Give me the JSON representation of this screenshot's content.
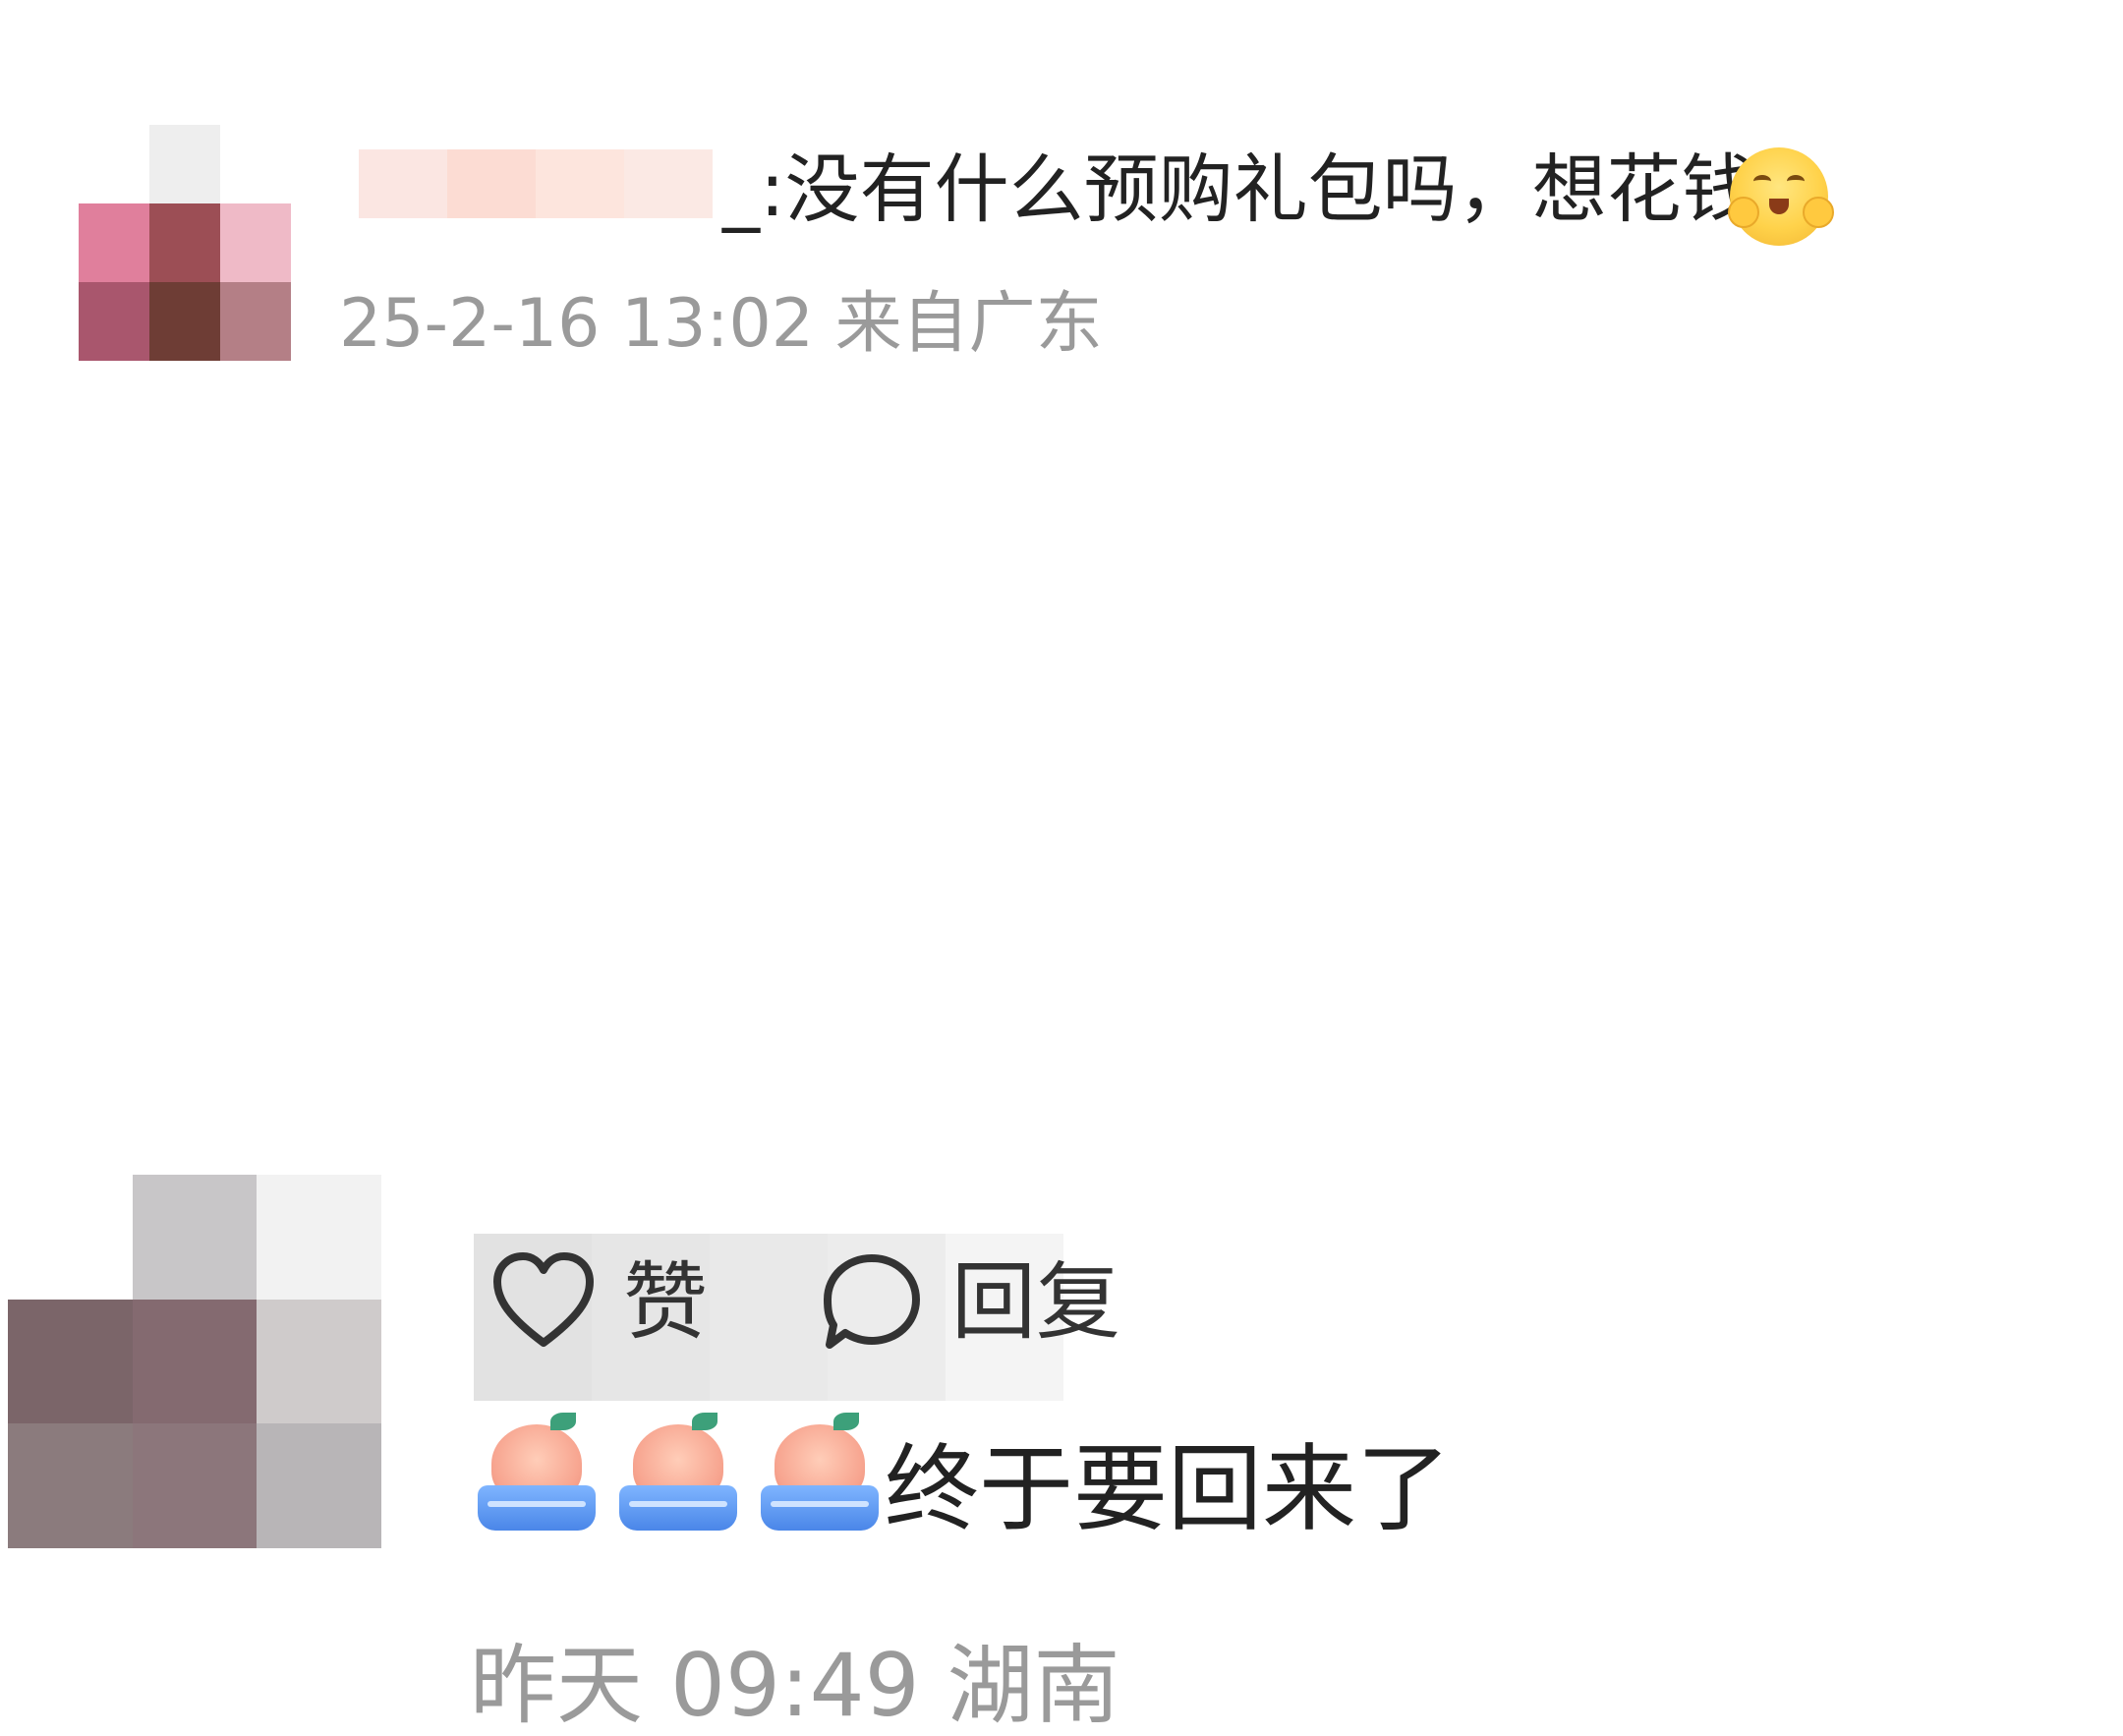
{
  "comments": [
    {
      "text": "_:没有什么预购礼包吗，想花钱",
      "meta": "25-2-16 13:02 来自广东",
      "emoji": "hugging-face-emoji",
      "avatar_colors": [
        "#f2f2f2",
        "#e9b9c7",
        "#f4cfd6",
        "#d98ca6",
        "#9c4b52",
        "#f0c6cd",
        "#a6556b",
        "#6b3b33",
        "#b07c83"
      ]
    },
    {
      "text": "终于要回来了",
      "meta": "昨天 09:49 湖南",
      "emoji": "peach-in-basin-emoji",
      "emoji_count": 3,
      "avatar_colors": [
        "#c9c6c8",
        "#a9a7ab",
        "#f1f1f1",
        "#7a6468",
        "#826a6e",
        "#cfcbcb",
        "#8a7a7c",
        "#8c767a",
        "#b7b4b6"
      ]
    }
  ],
  "actions": {
    "like_label": "赞",
    "reply_label": "回复"
  },
  "colors": {
    "text": "#222222",
    "meta": "#9a9a9a",
    "username_accent": "#e8542a"
  }
}
